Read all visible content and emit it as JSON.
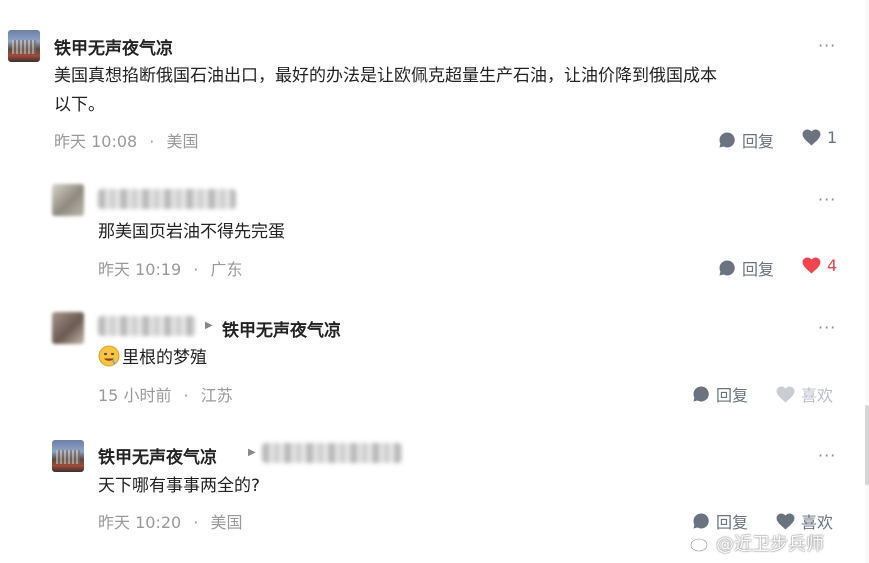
{
  "comments": [
    {
      "user": "铁甲无声夜气凉",
      "text_line1": "美国真想掐断俄国石油出口，最好的办法是让欧佩克超量生产石油，让油价降到俄国成本",
      "text_line2": "以下。",
      "time": "昨天 10:08",
      "location": "美国",
      "reply_label": "回复",
      "like_count": "1",
      "more_label": "···"
    },
    {
      "text": "那美国页岩油不得先完蛋",
      "time": "昨天 10:19",
      "location": "广东",
      "reply_label": "回复",
      "like_count": "4",
      "more_label": "···"
    },
    {
      "reply_to": "铁甲无声夜气凉",
      "text": "里根的梦殖",
      "time": "15 小时前",
      "location": "江苏",
      "reply_label": "回复",
      "like_label": "喜欢",
      "more_label": "···"
    },
    {
      "user": "铁甲无声夜气凉",
      "text": "天下哪有事事两全的?",
      "time": "昨天 10:20",
      "location": "美国",
      "reply_label": "回复",
      "like_label": "喜欢",
      "more_label": "···"
    }
  ],
  "separator": "·",
  "watermark": "@近卫步兵师",
  "colors": {
    "liked": "#f0444f",
    "icon": "#6b7280",
    "meta": "#999999"
  }
}
